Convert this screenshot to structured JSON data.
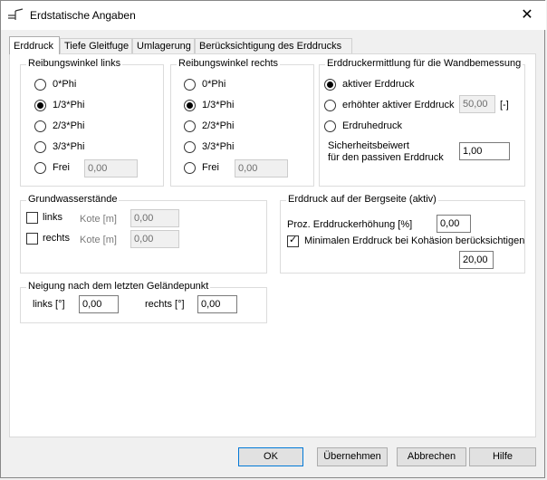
{
  "window": {
    "title": "Erdstatische Angaben",
    "app_icon": "symbol-icon",
    "close_glyph": "✕"
  },
  "tabs": [
    "Erddruck",
    "Tiefe Gleitfuge",
    "Umlagerung",
    "Berücksichtigung des Erddrucks"
  ],
  "reibung_links": {
    "title": "Reibungswinkel links",
    "options": [
      "0*Phi",
      "1/3*Phi",
      "2/3*Phi",
      "3/3*Phi",
      "Frei"
    ],
    "selected": "1/3*Phi",
    "frei_value": "0,00"
  },
  "reibung_rechts": {
    "title": "Reibungswinkel rechts",
    "options": [
      "0*Phi",
      "1/3*Phi",
      "2/3*Phi",
      "3/3*Phi",
      "Frei"
    ],
    "selected": "1/3*Phi",
    "frei_value": "0,00"
  },
  "wandbemessung": {
    "title": "Erddruckermittlung für die Wandbemessung",
    "opt_aktiv": "aktiver Erddruck",
    "opt_erhoeht": "erhöhter aktiver Erddruck",
    "erhoeht_value": "50,00",
    "erhoeht_unit": "[-]",
    "opt_ruhe": "Erdruhedruck",
    "selected": "aktiver Erddruck",
    "sicherheit_label_1": "Sicherheitsbeiwert",
    "sicherheit_label_2": "für den passiven Erddruck",
    "sicherheit_value": "1,00"
  },
  "grundwasser": {
    "title": "Grundwasserstände",
    "links_label": "links",
    "rechts_label": "rechts",
    "kote_label": "Kote [m]",
    "links_value": "0,00",
    "rechts_value": "0,00"
  },
  "bergseite": {
    "title": "Erddruck auf der Bergseite (aktiv)",
    "proz_label": "Proz. Erddruckerhöhung [%]",
    "proz_value": "0,00",
    "min_label": "Minimalen Erddruck bei Kohäsion berücksichtigen",
    "min_checked": true,
    "min_value": "20,00"
  },
  "neigung": {
    "title": "Neigung nach dem letzten Geländepunkt",
    "links_label": "links [°]",
    "links_value": "0,00",
    "rechts_label": "rechts [°]",
    "rechts_value": "0,00"
  },
  "buttons": {
    "ok": "OK",
    "apply": "Übernehmen",
    "cancel": "Abbrechen",
    "help": "Hilfe"
  }
}
